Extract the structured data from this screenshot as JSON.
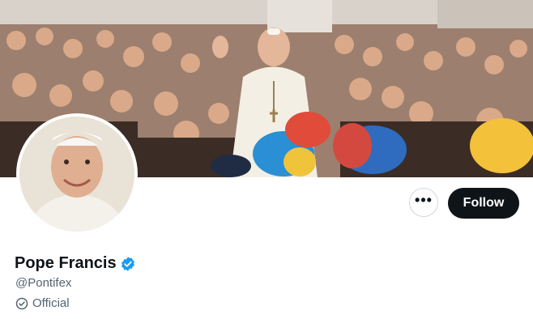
{
  "profile": {
    "display_name": "Pope Francis",
    "handle": "@Pontifex",
    "label": "Official"
  },
  "actions": {
    "more_label": "•••",
    "follow_label": "Follow"
  },
  "icons": {
    "verified": "verified-badge-icon",
    "official": "official-check-circle-icon",
    "more": "more-options-icon"
  },
  "colors": {
    "follow_bg": "#0f1419",
    "verified": "#1d9bf0",
    "secondary_text": "#536471"
  }
}
